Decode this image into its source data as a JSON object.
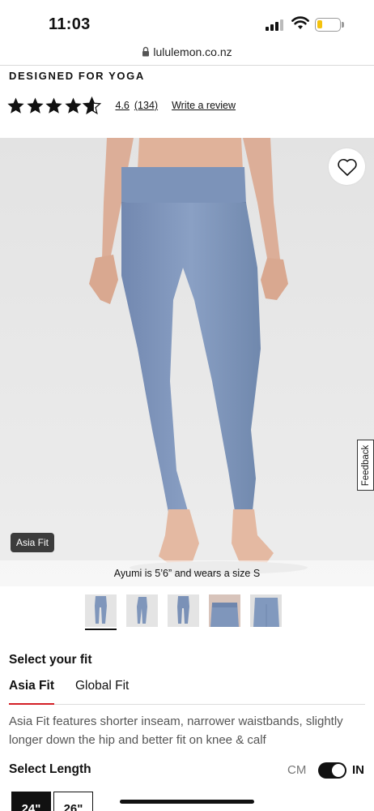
{
  "status_bar": {
    "time": "11:03",
    "battery_level": 0.22
  },
  "browser": {
    "url": "lululemon.co.nz"
  },
  "product": {
    "designed_for": "DESIGNED FOR YOGA",
    "rating": {
      "stars": 4.6,
      "value_label": "4.6",
      "count_label": "(134)",
      "write_review": "Write a review"
    }
  },
  "hero": {
    "badge": "Asia Fit",
    "caption": "Ayumi is 5’6” and wears a size S",
    "feedback_label": "Feedback"
  },
  "thumbnails": [
    {
      "label": "front"
    },
    {
      "label": "side"
    },
    {
      "label": "back"
    },
    {
      "label": "waist-detail"
    },
    {
      "label": "hip-detail"
    }
  ],
  "fit": {
    "heading": "Select your fit",
    "tabs": [
      {
        "label": "Asia Fit"
      },
      {
        "label": "Global Fit"
      }
    ],
    "description": "Asia Fit features shorter inseam, narrower waistbands, slightly longer down the hip and better fit on knee & calf"
  },
  "length": {
    "heading": "Select Length",
    "unit_cm": "CM",
    "unit_in": "IN",
    "options": [
      {
        "label": "24\""
      },
      {
        "label": "26\""
      }
    ]
  },
  "colors": {
    "accent": "#d31f26",
    "legging": "#7f96bb",
    "background": "#e8e8e8"
  }
}
